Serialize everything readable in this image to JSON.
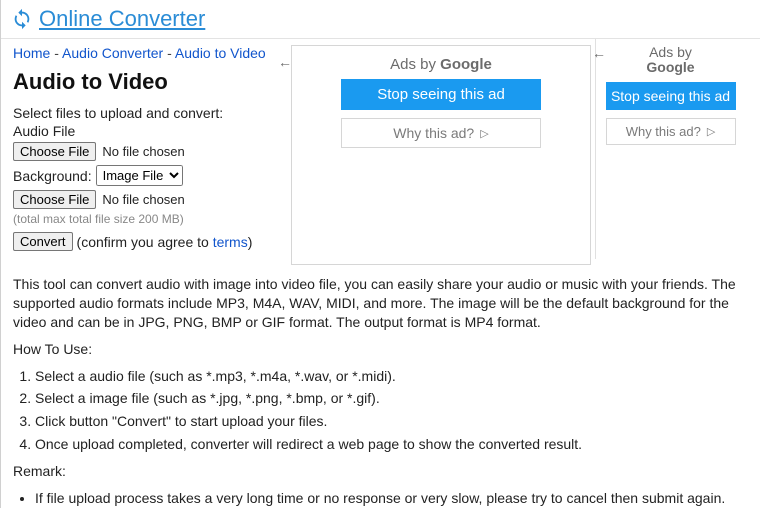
{
  "site": {
    "title": "Online Converter"
  },
  "breadcrumb": {
    "home": "Home",
    "cat": "Audio Converter",
    "page": "Audio to Video",
    "sep": "-"
  },
  "page_title": "Audio to Video",
  "form": {
    "select_label": "Select files to upload and convert:",
    "audio_label": "Audio File",
    "choose_btn": "Choose File",
    "no_file": "No file chosen",
    "bg_label": "Background:",
    "bg_option": "Image File",
    "hint": "(total max total file size 200 MB)",
    "convert_btn": "Convert",
    "confirm_prefix": "(confirm you agree to ",
    "terms": "terms",
    "confirm_suffix": ")"
  },
  "ads": {
    "by_prefix": "Ads by ",
    "google": "Google",
    "stop": "Stop seeing this ad",
    "why": "Why this ad?"
  },
  "desc": "This tool can convert audio with image into video file, you can easily share your audio or music with your friends. The supported audio formats include MP3, M4A, WAV, MIDI, and more. The image will be the default background for the video and can be in JPG, PNG, BMP or GIF format. The output format is MP4 format.",
  "howto_title": "How To Use:",
  "howto": [
    "Select a audio file (such as *.mp3, *.m4a, *.wav, or *.midi).",
    "Select a image file (such as *.jpg, *.png, *.bmp, or *.gif).",
    "Click button \"Convert\" to start upload your files.",
    "Once upload completed, converter will redirect a web page to show the converted result."
  ],
  "remark_title": "Remark:",
  "remarks": [
    "If file upload process takes a very long time or no response or very slow, please try to cancel then submit again."
  ]
}
